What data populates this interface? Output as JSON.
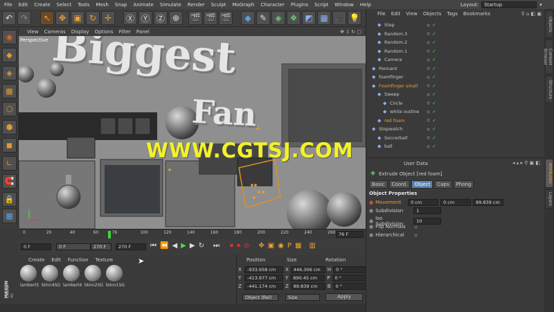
{
  "menu": [
    "File",
    "Edit",
    "Create",
    "Select",
    "Tools",
    "Mesh",
    "Snap",
    "Animate",
    "Simulate",
    "Render",
    "Sculpt",
    "MoGraph",
    "Character",
    "Plugins",
    "Script",
    "Window",
    "Help"
  ],
  "layout": {
    "label": "Layout:",
    "value": "Startup"
  },
  "viewport": {
    "menu": [
      "View",
      "Cameras",
      "Display",
      "Options",
      "Filter",
      "Panel"
    ],
    "label": "Perspective",
    "scene_text_1": "Biggest",
    "scene_text_2": "Fan",
    "watermark": "WWW.CGTSJ.COM"
  },
  "timeline": {
    "ticks": [
      "0",
      "20",
      "40",
      "60",
      "76",
      "100",
      "120",
      "140",
      "160",
      "180",
      "200",
      "220",
      "240",
      "260"
    ],
    "current_frame_box": "76 F"
  },
  "transport": {
    "start": "0 F",
    "range_start": "0 F",
    "range_end": "270 F",
    "end": "270 F"
  },
  "material": {
    "menu": [
      "Create",
      "Edit",
      "Function",
      "Texture"
    ],
    "items": [
      "lambert5",
      "blinn4SG",
      "lambert4",
      "blinn2SG",
      "blinn1SG"
    ]
  },
  "coords": {
    "headers": [
      "Position",
      "Size",
      "Rotation"
    ],
    "rows": [
      {
        "axis": "X",
        "pos": "-933.658 cm",
        "size": "446.306 cm",
        "rlabel": "H",
        "rot": "0 °"
      },
      {
        "axis": "Y",
        "pos": "-413.977 cm",
        "size": "890.45 cm",
        "rlabel": "P",
        "rot": "0 °"
      },
      {
        "axis": "Z",
        "pos": "-441.174 cm",
        "size": "89.839 cm",
        "rlabel": "B",
        "rot": "0 °"
      }
    ],
    "mode": "Object (Rel)",
    "size_mode": "Size",
    "apply": "Apply"
  },
  "objects": {
    "menu": [
      "File",
      "Edit",
      "View",
      "Objects",
      "Tags",
      "Bookmarks"
    ],
    "rows": [
      {
        "name": "Step",
        "indent": 1,
        "color": "#c9c9c9"
      },
      {
        "name": "Random.3",
        "indent": 1,
        "color": "#c9c9c9"
      },
      {
        "name": "Random.2",
        "indent": 1,
        "color": "#c9c9c9"
      },
      {
        "name": "Random.1",
        "indent": 1,
        "color": "#c9c9c9"
      },
      {
        "name": "Camera",
        "indent": 1,
        "color": "#c9c9c9"
      },
      {
        "name": "Pennant",
        "indent": 0,
        "color": "#c9c9c9"
      },
      {
        "name": "foamfinger",
        "indent": 0,
        "color": "#c9c9c9"
      },
      {
        "name": "Foamfinger small",
        "indent": 0,
        "color": "#f0a030"
      },
      {
        "name": "Sweep",
        "indent": 1,
        "color": "#c9c9c9"
      },
      {
        "name": "Circle",
        "indent": 2,
        "color": "#c9c9c9"
      },
      {
        "name": "white outline",
        "indent": 2,
        "color": "#c9c9c9"
      },
      {
        "name": "red foam",
        "indent": 1,
        "color": "#f0a030"
      },
      {
        "name": "Stopwatch",
        "indent": 0,
        "color": "#c9c9c9"
      },
      {
        "name": "Soccerball",
        "indent": 1,
        "color": "#c9c9c9"
      },
      {
        "name": "ball",
        "indent": 1,
        "color": "#c9c9c9"
      }
    ]
  },
  "attributes": {
    "header": "User Data",
    "title": "Extrude Object [red foam]",
    "tabs": [
      "Basic",
      "Coord.",
      "Object",
      "Caps",
      "Phong"
    ],
    "section": "Object Properties",
    "movement": {
      "label": "Movement",
      "v1": "0 cm",
      "v2": "0 cm",
      "v3": "89.839 cm"
    },
    "subdivision": {
      "label": "Subdivision",
      "value": "1"
    },
    "iso": {
      "label": "Iso Subdivision",
      "value": "10"
    },
    "flip": {
      "label": "Flip Normals"
    },
    "hier": {
      "label": "Hierarchical"
    }
  },
  "sidetabs": [
    "Objects",
    "Content Browser",
    "Structure",
    "Attributes",
    "Layers"
  ],
  "brand": {
    "line1": "MAXON",
    "line2": "CINEMA 4D"
  }
}
